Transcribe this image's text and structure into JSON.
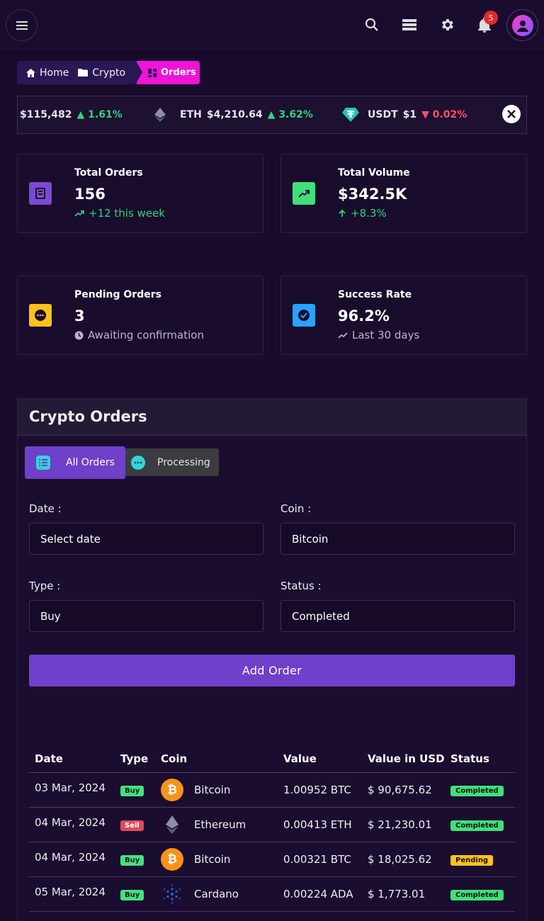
{
  "topbar": {
    "icons": [
      "menu-icon",
      "search-icon",
      "layers-icon",
      "gear-icon",
      "bell-icon",
      "avatar"
    ],
    "notifications_count": "5"
  },
  "breadcrumb": {
    "items": [
      {
        "label": "Home",
        "icon": "home-icon"
      },
      {
        "label": "Crypto",
        "icon": "folder-icon"
      },
      {
        "label": "Orders",
        "icon": "grid-icon"
      }
    ]
  },
  "ticker": {
    "items": [
      {
        "symbol": "",
        "price": "$115,482",
        "change": "1.61%",
        "direction": "up"
      },
      {
        "symbol": "ETH",
        "price": "$4,210.64",
        "change": "3.62%",
        "direction": "up"
      },
      {
        "symbol": "USDT",
        "price": "$1",
        "change": "0.02%",
        "direction": "down"
      }
    ]
  },
  "stats": [
    {
      "title": "Total Orders",
      "value": "156",
      "sub": "+12 this week",
      "icon": "receipt-icon",
      "color": "#7a4bd1"
    },
    {
      "title": "Total Volume",
      "value": "$342.5K",
      "sub": "+8.3%",
      "icon": "trending-up-icon",
      "color": "#3fe07a"
    },
    {
      "title": "Pending Orders",
      "value": "3",
      "sub": "Awaiting confirmation",
      "icon": "dots-icon",
      "color": "#ffc21c"
    },
    {
      "title": "Success Rate",
      "value": "96.2%",
      "sub": "Last 30 days",
      "icon": "check-icon",
      "color": "#27a2ff"
    }
  ],
  "orders": {
    "title": "Crypto Orders",
    "tabs": [
      {
        "label": "All Orders",
        "active": true
      },
      {
        "label": "Processing",
        "active": false
      }
    ],
    "form": {
      "date_label": "Date :",
      "date_value": "Select date",
      "coin_label": "Coin :",
      "coin_value": "Bitcoin",
      "type_label": "Type :",
      "type_value": "Buy",
      "status_label": "Status :",
      "status_value": "Completed",
      "add_button": "Add Order"
    },
    "table": {
      "headers": [
        "Date",
        "Type",
        "Coin",
        "Value",
        "Value in USD",
        "Status"
      ],
      "rows": [
        {
          "date": "03 Mar, 2024",
          "type": "Buy",
          "coin": "Bitcoin",
          "value": "1.00952 BTC",
          "usd": "$ 90,675.62",
          "status": "Completed"
        },
        {
          "date": "04 Mar, 2024",
          "type": "Sell",
          "coin": "Ethereum",
          "value": "0.00413 ETH",
          "usd": "$ 21,230.01",
          "status": "Completed"
        },
        {
          "date": "04 Mar, 2024",
          "type": "Buy",
          "coin": "Bitcoin",
          "value": "0.00321 BTC",
          "usd": "$ 18,025.62",
          "status": "Pending"
        },
        {
          "date": "05 Mar, 2024",
          "type": "Buy",
          "coin": "Cardano",
          "value": "0.00224 ADA",
          "usd": "$ 1,773.01",
          "status": "Completed"
        }
      ]
    }
  }
}
